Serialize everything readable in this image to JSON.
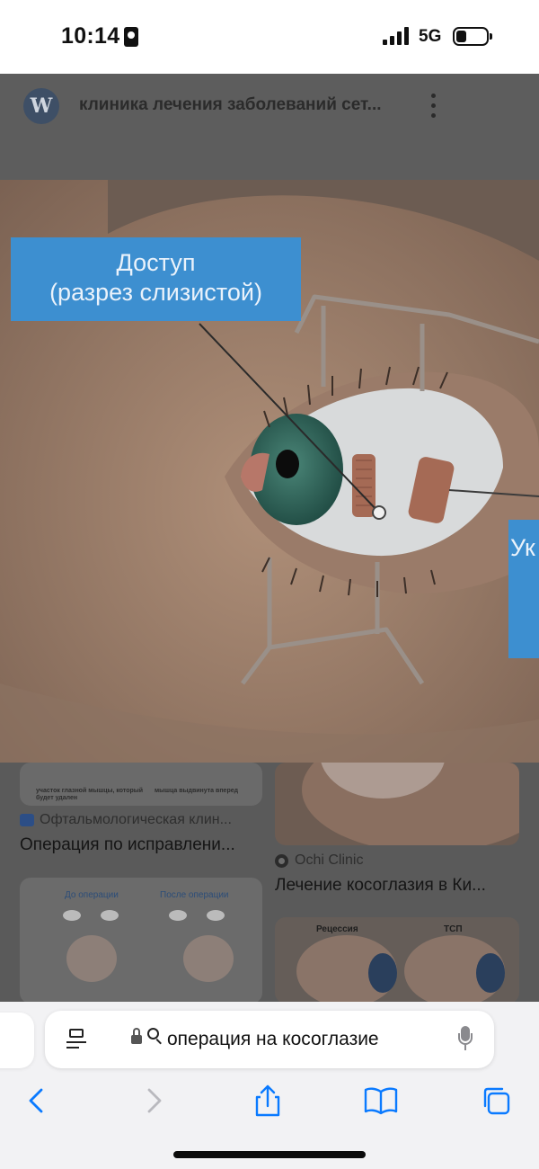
{
  "status_bar": {
    "time": "10:14",
    "network": "5G"
  },
  "viewer": {
    "site_icon": "wordpress-logo",
    "title": "клиника лечения заболеваний сет..."
  },
  "image": {
    "callout_access_line1": "Доступ",
    "callout_access_line2": "(разрез слизистой)",
    "callout_right_partial": "Ук"
  },
  "results": [
    {
      "source": "Офтальмологическая клин...",
      "title": "Операция по исправлени...",
      "thumb_caption_left": "участок глазной мышцы, который будет удален",
      "thumb_caption_right": "мышца выдвинута вперед"
    },
    {
      "source": "Ochi Clinic",
      "title": "Лечение косоглазия в Ки..."
    },
    {
      "thumb_label_before": "До операции",
      "thumb_label_after": "После операции"
    },
    {
      "thumb_label_left": "Рецессия",
      "thumb_label_right": "ТСП"
    }
  ],
  "toolbar": {
    "address_text": "операция на косоглазие"
  },
  "colors": {
    "callout_blue": "#3d8fd0",
    "toolbar_bg": "#f2f2f4",
    "accent": "#0a7aff"
  }
}
